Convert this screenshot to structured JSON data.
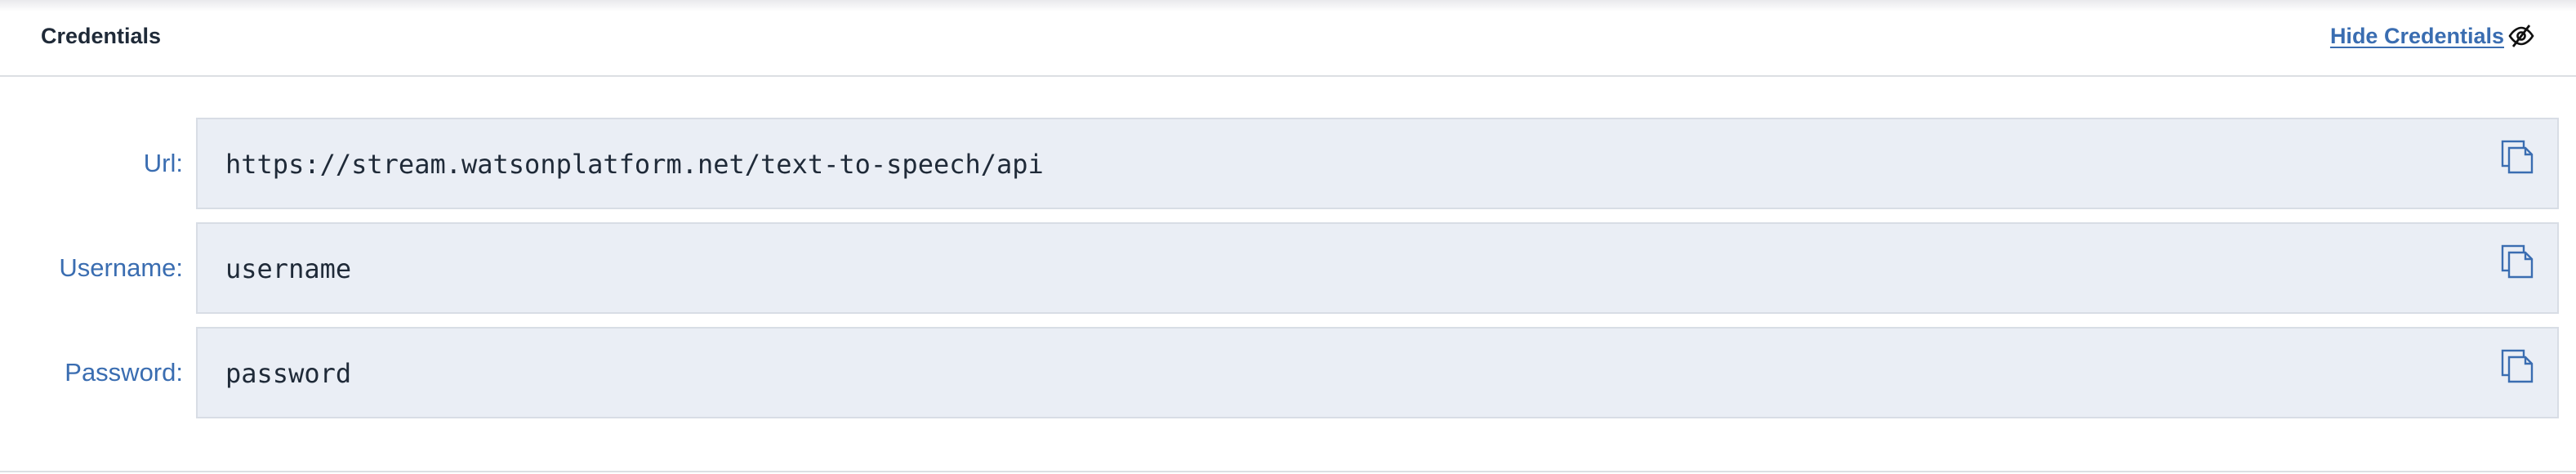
{
  "header": {
    "title": "Credentials",
    "hide_label": "Hide Credentials",
    "hide_icon": "eye-slash-icon"
  },
  "credentials": {
    "url": {
      "label": "Url:",
      "value": "https://stream.watsonplatform.net/text-to-speech/api",
      "copy_icon": "copy-icon"
    },
    "username": {
      "label": "Username:",
      "value": "username",
      "copy_icon": "copy-icon"
    },
    "password": {
      "label": "Password:",
      "value": "password",
      "copy_icon": "copy-icon"
    }
  },
  "colors": {
    "accent": "#3a6db1",
    "field_background": "#eaeef5",
    "title_text": "#1f2a38"
  }
}
